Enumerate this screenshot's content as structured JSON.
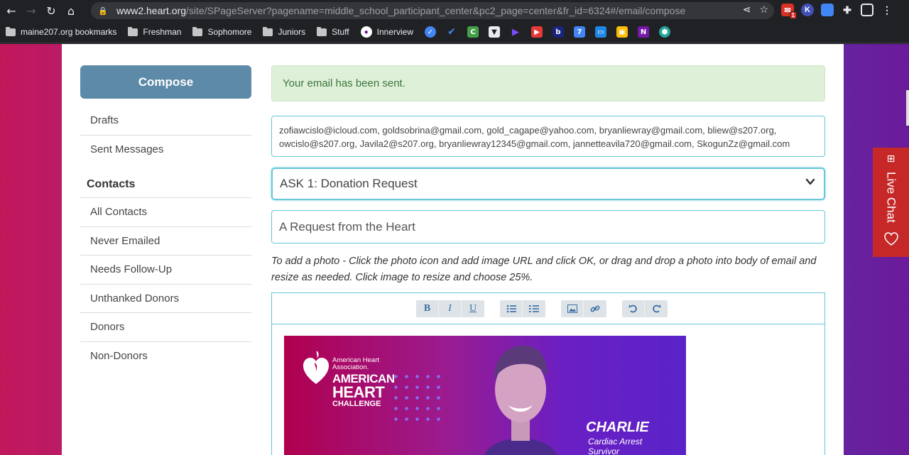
{
  "browser": {
    "url_host": "www2.heart.org",
    "url_path": "/site/SPageServer?pagename=middle_school_participant_center&pc2_page=center&fr_id=6324#/email/compose",
    "mail_badge": "1",
    "ext_k": "K",
    "bookmarks": [
      {
        "label": "maine207.org bookmarks",
        "icon": "bookmarks-folder-icon"
      },
      {
        "label": "Freshman",
        "icon": "folder-icon"
      },
      {
        "label": "Sophomore",
        "icon": "folder-icon"
      },
      {
        "label": "Juniors",
        "icon": "folder-icon"
      },
      {
        "label": "Stuff",
        "icon": "folder-icon"
      },
      {
        "label": "Innerview",
        "icon": "innerview-icon"
      }
    ]
  },
  "sidebar": {
    "compose_label": "Compose",
    "items_top": [
      "Drafts",
      "Sent Messages"
    ],
    "contacts_heading": "Contacts",
    "contact_items": [
      "All Contacts",
      "Never Emailed",
      "Needs Follow-Up",
      "Unthanked Donors",
      "Donors",
      "Non-Donors"
    ]
  },
  "main": {
    "alert": "Your email has been sent.",
    "recipients": "zofiawcislo@icloud.com, goldsobrina@gmail.com, gold_cagape@yahoo.com, bryanliewray@gmail.com, bliew@s207.org, owcislo@s207.org, Javila2@s207.org, bryanliewray12345@gmail.com, jannetteavila720@gmail.com, SkogunZz@gmail.com",
    "template_selected": "ASK 1: Donation Request",
    "subject": "A Request from the Heart",
    "photo_hint": "To add a photo - Click the photo icon and add image URL and click OK, or drag and drop a photo into body of email and resize as needed. Click image to resize and choose 25%.",
    "toolbar": {
      "bold": "B",
      "italic": "I",
      "underline": "U"
    },
    "banner": {
      "assoc_line1": "American Heart",
      "assoc_line2": "Association.",
      "title_line1": "AMERICAN",
      "title_line2": "HEART",
      "title_line3": "CHALLENGE",
      "name": "CHARLIE",
      "sub_line1": "Cardiac Arrest",
      "sub_line2": "Survivor"
    }
  },
  "livechat": {
    "label": "Live Chat"
  },
  "colors": {
    "compose": "#5d8aa8",
    "alert_bg": "#dff0d8",
    "alert_text": "#3c763d",
    "input_border": "#66c7d6",
    "livechat": "#c62828"
  }
}
